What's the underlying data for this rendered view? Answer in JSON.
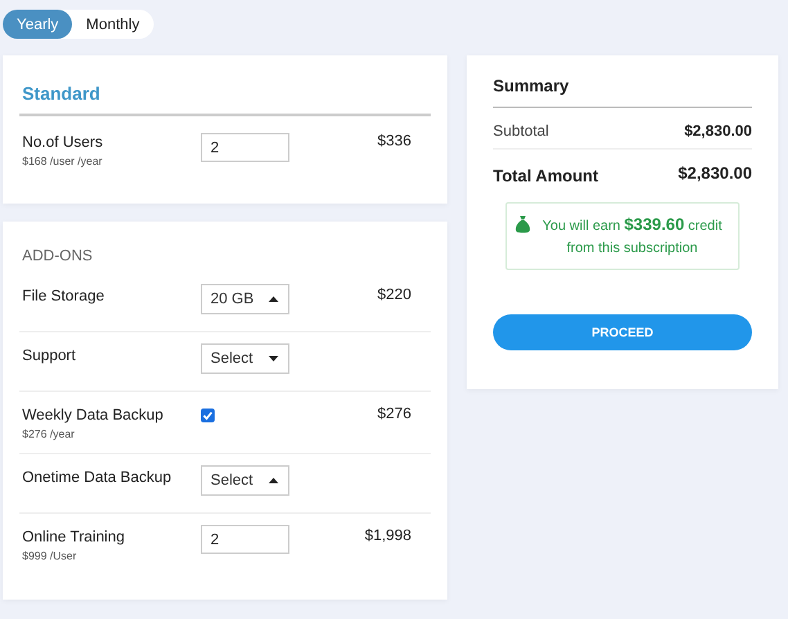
{
  "billing_toggle": [
    {
      "label": "Yearly",
      "selected": true
    },
    {
      "label": "Monthly",
      "selected": false
    }
  ],
  "standard": {
    "title": "Standard",
    "users": {
      "label": "No.of Users",
      "sub": "$168 /user /year",
      "value": "2",
      "price": "$336"
    }
  },
  "addons": {
    "title": "ADD-ONS",
    "items": [
      {
        "kind": "select",
        "label": "File Storage",
        "value": "20 GB",
        "expanded": true,
        "price": "$220"
      },
      {
        "kind": "select",
        "label": "Support",
        "value": "Select",
        "expanded": false
      },
      {
        "kind": "checkbox",
        "label": "Weekly Data Backup",
        "sub": "$276 /year",
        "checked": true,
        "price": "$276"
      },
      {
        "kind": "select",
        "label": "Onetime Data Backup",
        "value": "Select",
        "expanded": true
      },
      {
        "kind": "number",
        "label": "Online Training",
        "sub": "$999 /User",
        "value": "2",
        "price": "$1,998"
      }
    ]
  },
  "summary": {
    "title": "Summary",
    "subtotal_label": "Subtotal",
    "subtotal": "$2,830.00",
    "total_label": "Total Amount",
    "total": "$2,830.00",
    "credit": "You will earn **$339.60** credit from this subscription",
    "button": "PROCEED"
  }
}
